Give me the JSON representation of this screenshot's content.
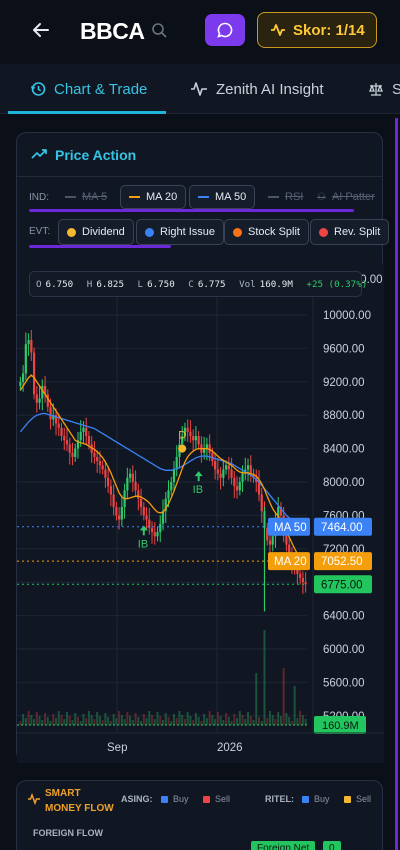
{
  "header": {
    "title": "BBCA",
    "score_label": "Skor: 1/14"
  },
  "tabs": [
    {
      "label": "Chart & Trade",
      "icon": "history-icon"
    },
    {
      "label": "Zenith AI Insight",
      "icon": "pulse-icon"
    },
    {
      "label": "S",
      "icon": "scale-icon"
    }
  ],
  "price_action": {
    "title": "Price Action",
    "ind_label": "IND:",
    "evt_label": "EVT:",
    "indicators": [
      {
        "label": "MA 5",
        "enabled": false,
        "color": "#6b7280"
      },
      {
        "label": "MA 20",
        "enabled": true,
        "color": "#f59e0b"
      },
      {
        "label": "MA 50",
        "enabled": true,
        "color": "#3b82f6"
      },
      {
        "label": "RSI",
        "enabled": false,
        "color": "#6b7280"
      },
      {
        "label": "AI Patter",
        "enabled": false,
        "color": "#6b7280"
      }
    ],
    "events": [
      {
        "label": "Dividend",
        "color": "#f5b82e"
      },
      {
        "label": "Right Issue",
        "color": "#3b82f6"
      },
      {
        "label": "Stock Split",
        "color": "#f97316"
      },
      {
        "label": "Rev. Split",
        "color": "#ef4444"
      }
    ],
    "ohlc": {
      "o_label": "O",
      "o": "6.750",
      "h_label": "H",
      "h": "6.825",
      "l_label": "L",
      "l": "6.750",
      "c_label": "C",
      "c": "6.775",
      "vol_label": "Vol",
      "vol": "160.9M",
      "change": "+25 (0.37%)"
    }
  },
  "chart_data": {
    "type": "candlestick",
    "x_ticks": [
      "Sep",
      "2026"
    ],
    "y_ticks": [
      10000,
      9600,
      9200,
      8800,
      8400,
      8000,
      7600,
      7200,
      6800,
      6400,
      6000,
      5600,
      5200
    ],
    "y_tick_labels": [
      "10000.00",
      "9600.00",
      "9200.00",
      "8800.00",
      "8400.00",
      "8000.00",
      "7600.00",
      "7200.00",
      "6800.00",
      "6400.00",
      "6000.00",
      "5600.00",
      "5200.00"
    ],
    "top_partial_tick": "7200",
    "ylim": [
      5000,
      10400
    ],
    "price_lines": [
      {
        "name": "MA 50",
        "value": 7464.0,
        "label": "7464.00",
        "color": "#3b82f6"
      },
      {
        "name": "MA 20",
        "value": 7052.5,
        "label": "7052.50",
        "color": "#f59e0b"
      },
      {
        "name": "Close",
        "value": 6775.0,
        "label": "6775.00",
        "color": "#22c55e"
      }
    ],
    "volume_label": "160.9M",
    "close_series": [
      9200,
      9300,
      9650,
      9700,
      9550,
      9050,
      8950,
      9000,
      9150,
      9050,
      8900,
      8750,
      8800,
      8700,
      8650,
      8550,
      8500,
      8450,
      8350,
      8300,
      8400,
      8500,
      8600,
      8650,
      8550,
      8450,
      8350,
      8300,
      8250,
      8200,
      8150,
      8050,
      7950,
      7850,
      7700,
      7600,
      7550,
      7700,
      7900,
      8050,
      8100,
      8000,
      7900,
      7800,
      7700,
      7600,
      7550,
      7450,
      7400,
      7350,
      7400,
      7500,
      7650,
      7800,
      7900,
      8000,
      8150,
      8300,
      8450,
      8550,
      8650,
      8600,
      8550,
      8500,
      8550,
      8450,
      8350,
      8400,
      8450,
      8350,
      8250,
      8150,
      8100,
      8050,
      8150,
      8200,
      8150,
      8050,
      7950,
      7900,
      8000,
      8100,
      8150,
      8200,
      8100,
      8050,
      8000,
      7850,
      7650,
      7450,
      7300,
      7250,
      7350,
      7550,
      7700,
      7600,
      7400,
      7250,
      7100,
      7000,
      6950,
      6900,
      6850,
      6800,
      6775
    ],
    "ma20": [
      9100,
      9150,
      9200,
      9250,
      9280,
      9250,
      9200,
      9150,
      9100,
      9050,
      9000,
      8950,
      8900,
      8850,
      8800,
      8750,
      8700,
      8650,
      8600,
      8550,
      8500,
      8480,
      8470,
      8460,
      8450,
      8430,
      8410,
      8390,
      8360,
      8330,
      8290,
      8240,
      8180,
      8110,
      8030,
      7950,
      7870,
      7820,
      7800,
      7800,
      7810,
      7820,
      7830,
      7830,
      7820,
      7800,
      7780,
      7750,
      7710,
      7670,
      7640,
      7630,
      7640,
      7680,
      7740,
      7810,
      7890,
      7980,
      8070,
      8160,
      8240,
      8300,
      8340,
      8370,
      8390,
      8400,
      8400,
      8400,
      8400,
      8390,
      8370,
      8340,
      8310,
      8280,
      8260,
      8240,
      8220,
      8200,
      8170,
      8140,
      8120,
      8110,
      8110,
      8110,
      8100,
      8090,
      8070,
      8030,
      7980,
      7910,
      7830,
      7750,
      7680,
      7630,
      7590,
      7540,
      7480,
      7410,
      7340,
      7270,
      7200,
      7140,
      7090,
      7060,
      7052
    ],
    "ma50": [
      8600,
      8640,
      8680,
      8720,
      8750,
      8780,
      8800,
      8810,
      8820,
      8820,
      8810,
      8800,
      8790,
      8780,
      8770,
      8760,
      8750,
      8740,
      8730,
      8720,
      8710,
      8700,
      8690,
      8680,
      8670,
      8660,
      8650,
      8640,
      8620,
      8600,
      8580,
      8560,
      8540,
      8520,
      8500,
      8480,
      8460,
      8440,
      8420,
      8400,
      8380,
      8360,
      8340,
      8320,
      8300,
      8280,
      8260,
      8240,
      8220,
      8200,
      8180,
      8160,
      8150,
      8140,
      8140,
      8140,
      8150,
      8160,
      8170,
      8190,
      8210,
      8230,
      8250,
      8270,
      8290,
      8300,
      8310,
      8310,
      8310,
      8300,
      8290,
      8280,
      8270,
      8260,
      8250,
      8240,
      8230,
      8220,
      8200,
      8180,
      8160,
      8140,
      8120,
      8100,
      8080,
      8060,
      8030,
      8000,
      7960,
      7920,
      7880,
      7840,
      7800,
      7760,
      7720,
      7680,
      7640,
      7600,
      7570,
      7540,
      7510,
      7490,
      7475,
      7468,
      7464
    ],
    "events": [
      {
        "type": "Dividend",
        "marker": "D",
        "index": 59,
        "value": 8400
      },
      {
        "type": "Right Issue",
        "marker": "IB",
        "index": 45,
        "value": 7600
      },
      {
        "type": "Right Issue",
        "marker": "IB",
        "index": 65,
        "value": 8250
      }
    ]
  },
  "smart_money": {
    "title_line1": "SMART",
    "title_line2": "MONEY FLOW",
    "asing_label": "ASING:",
    "ritel_label": "RITEL:",
    "buy_label": "Buy",
    "sell_label": "Sell",
    "buy_label2": "Buy",
    "sell_label2": "Sell",
    "foreign_flow_label": "FOREIGN FLOW",
    "foreign_net_label": "Foreign Net",
    "foreign_net_value": "0"
  }
}
